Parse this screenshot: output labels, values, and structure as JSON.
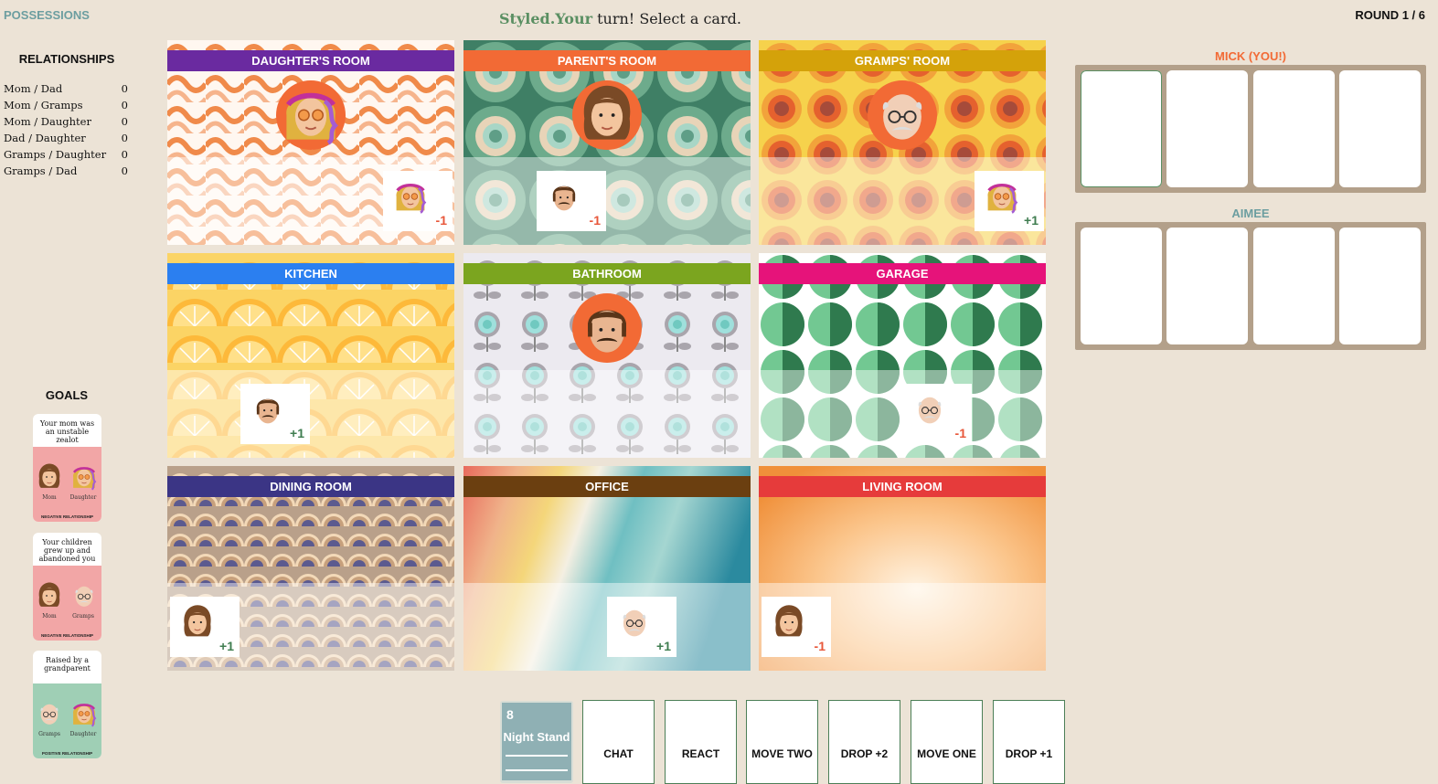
{
  "header": {
    "possessions_label": "Possessions",
    "turn_player": "Styled.Your",
    "turn_rest": " turn! Select a card.",
    "round_label": "Round 1 / 6"
  },
  "relationships": {
    "title": "Relationships",
    "items": [
      {
        "pair": "Mom / Dad",
        "value": "0"
      },
      {
        "pair": "Mom / Gramps",
        "value": "0"
      },
      {
        "pair": "Mom / Daughter",
        "value": "0"
      },
      {
        "pair": "Dad / Daughter",
        "value": "0"
      },
      {
        "pair": "Gramps / Daughter",
        "value": "0"
      },
      {
        "pair": "Gramps / Dad",
        "value": "0"
      }
    ]
  },
  "goals": {
    "title": "Goals",
    "items": [
      {
        "text": "Your mom was an unstable zealot",
        "left": "Mom",
        "right": "Daughter",
        "footer": "NEGATIVE RELATIONSHIP",
        "color": "#f2a6a6"
      },
      {
        "text": "Your children grew up and abandoned you",
        "left": "Mom",
        "right": "Gramps",
        "footer": "NEGATIVE RELATIONSHIP",
        "color": "#f2a6a6"
      },
      {
        "text": "Raised by a grandparent",
        "left": "Gramps",
        "right": "Daughter",
        "footer": "POSITIVE RELATIONSHIP",
        "color": "#9fcfb5"
      }
    ]
  },
  "rooms": [
    {
      "name": "Daughter's Room",
      "color": "#6a2aa0",
      "occupant": "daughter",
      "card_face": "daughter",
      "mod": "-1"
    },
    {
      "name": "Parent's Room",
      "color": "#f26a35",
      "occupant": "mom",
      "card_face": "dad",
      "mod": "-1"
    },
    {
      "name": "Gramps' Room",
      "color": "#d4a20a",
      "occupant": "gramps",
      "card_face": "daughter",
      "mod": "+1"
    },
    {
      "name": "Kitchen",
      "color": "#2b7ff0",
      "occupant": "",
      "card_face": "dad",
      "mod": "+1"
    },
    {
      "name": "Bathroom",
      "color": "#7ba51f",
      "occupant": "dad",
      "card_face": "",
      "mod": ""
    },
    {
      "name": "Garage",
      "color": "#e6137a",
      "occupant": "",
      "card_face": "gramps",
      "mod": "-1"
    },
    {
      "name": "Dining Room",
      "color": "#3b3585",
      "occupant": "",
      "card_face": "mom",
      "mod": "+1"
    },
    {
      "name": "Office",
      "color": "#6b3f10",
      "occupant": "",
      "card_face": "gramps",
      "mod": "+1"
    },
    {
      "name": "Living Room",
      "color": "#e63b3b",
      "occupant": "",
      "card_face": "mom",
      "mod": "-1"
    }
  ],
  "players": [
    {
      "name": "Mick (you!)",
      "color": "#f26a35"
    },
    {
      "name": "Aimee",
      "color": "#6c9ea0"
    }
  ],
  "deck": {
    "count": "8",
    "title": "Night Stand"
  },
  "actions": [
    "Chat",
    "React",
    "Move Two",
    "Drop +2",
    "Move One",
    "Drop +1"
  ],
  "colors": {
    "background": "#ece3d6",
    "accent_green": "#5a8f62",
    "accent_orange": "#f26a35",
    "hand_bg": "#b3a08a"
  }
}
